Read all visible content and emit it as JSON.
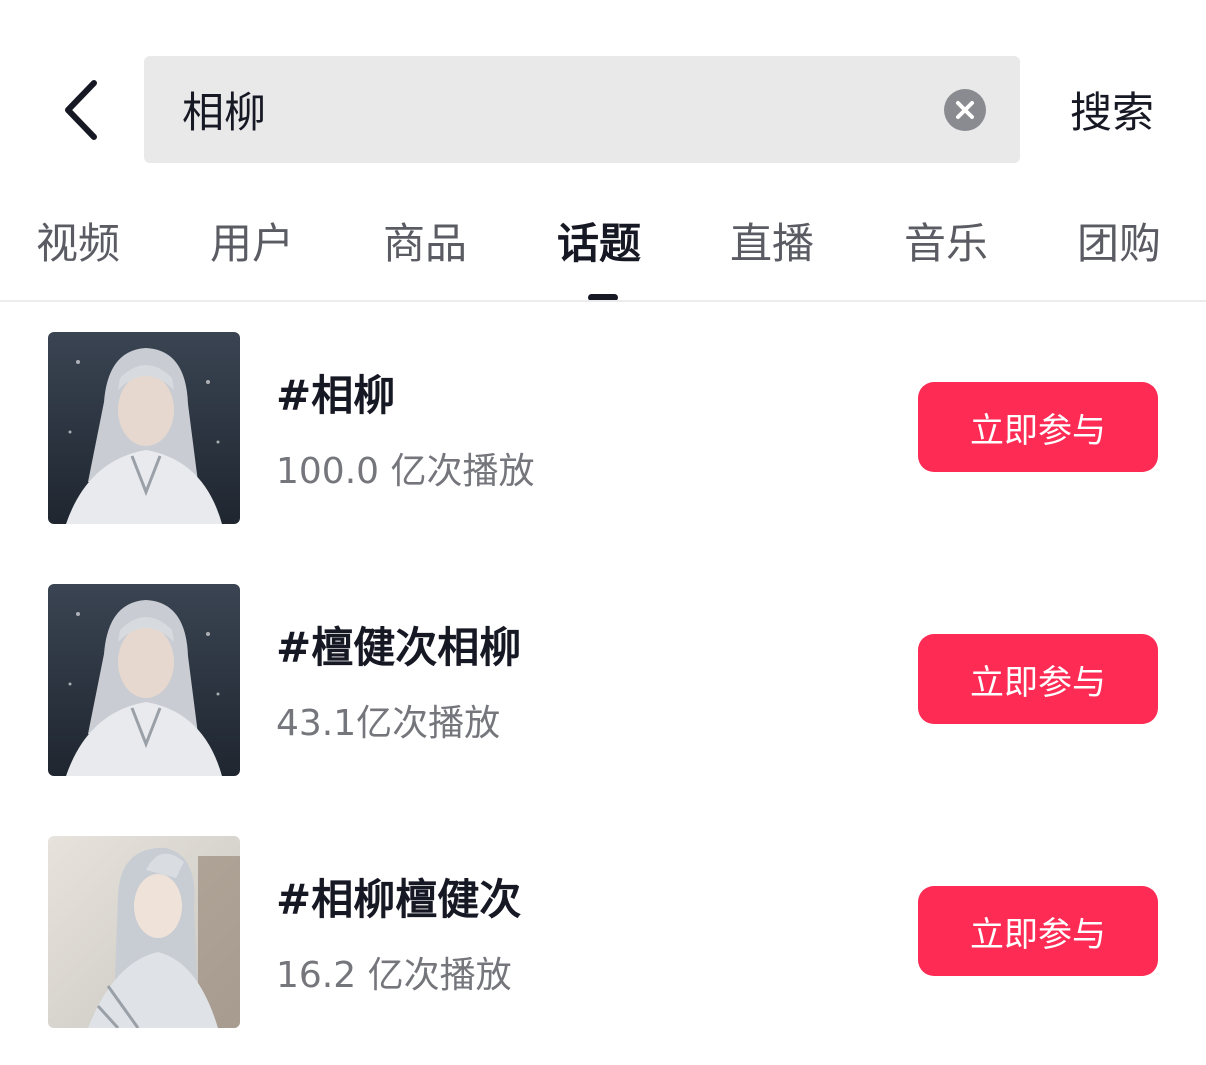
{
  "search": {
    "query": "相柳",
    "submit_label": "搜索"
  },
  "icons": {
    "back": "chevron-left-icon",
    "clear": "close-circle-icon"
  },
  "tabs": [
    {
      "label": "视频",
      "active": false
    },
    {
      "label": "用户",
      "active": false
    },
    {
      "label": "商品",
      "active": false
    },
    {
      "label": "话题",
      "active": true
    },
    {
      "label": "直播",
      "active": false
    },
    {
      "label": "音乐",
      "active": false
    },
    {
      "label": "团购",
      "active": false
    }
  ],
  "topics": [
    {
      "title": "#相柳",
      "views": "100.0 亿次播放",
      "action_label": "立即参与"
    },
    {
      "title": "#檀健次相柳",
      "views": "43.1亿次播放",
      "action_label": "立即参与"
    },
    {
      "title": "#相柳檀健次",
      "views": "16.2 亿次播放",
      "action_label": "立即参与"
    }
  ],
  "colors": {
    "accent": "#fe2c55",
    "text_primary": "#161823",
    "text_secondary": "#75767c",
    "search_bg": "#e9e9ea"
  }
}
